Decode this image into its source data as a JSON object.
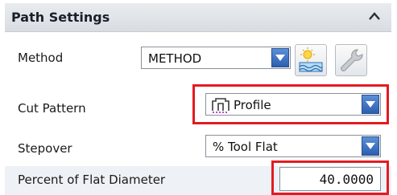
{
  "panel": {
    "title": "Path Settings",
    "collapse_icon": "chevron-up-icon"
  },
  "method": {
    "label": "Method",
    "value": "METHOD",
    "display_icon": "display-method-icon",
    "edit_icon": "wrench-icon"
  },
  "cut_pattern": {
    "label": "Cut Pattern",
    "value": "Profile",
    "icon": "profile-pattern-icon"
  },
  "stepover": {
    "label": "Stepover",
    "value": "% Tool Flat"
  },
  "percent_flat": {
    "label": "Percent of Flat Diameter",
    "value": "40.0000"
  },
  "colors": {
    "highlight": "#e21b23",
    "dropdown_arrow": "#2c5fb0"
  }
}
